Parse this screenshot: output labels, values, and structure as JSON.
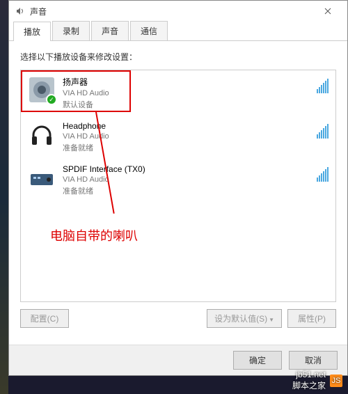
{
  "window": {
    "title": "声音"
  },
  "tabs": [
    {
      "label": "播放"
    },
    {
      "label": "录制"
    },
    {
      "label": "声音"
    },
    {
      "label": "通信"
    }
  ],
  "instruction": "选择以下播放设备来修改设置：",
  "devices": [
    {
      "name": "扬声器",
      "driver": "VIA HD Audio",
      "status": "默认设备",
      "type": "speaker",
      "default": true
    },
    {
      "name": "Headphone",
      "driver": "VIA HD Audio",
      "status": "准备就绪",
      "type": "headphone",
      "default": false
    },
    {
      "name": "SPDIF Interface (TX0)",
      "driver": "VIA HD Audio",
      "status": "准备就绪",
      "type": "spdif",
      "default": false
    }
  ],
  "annotation": "电脑自带的喇叭",
  "buttons": {
    "configure": "配置(C)",
    "set_default": "设为默认值(S)",
    "properties": "属性(P)",
    "ok": "确定",
    "cancel": "取消"
  },
  "watermark": {
    "url": "jb51.net",
    "text": "脚本之家"
  }
}
